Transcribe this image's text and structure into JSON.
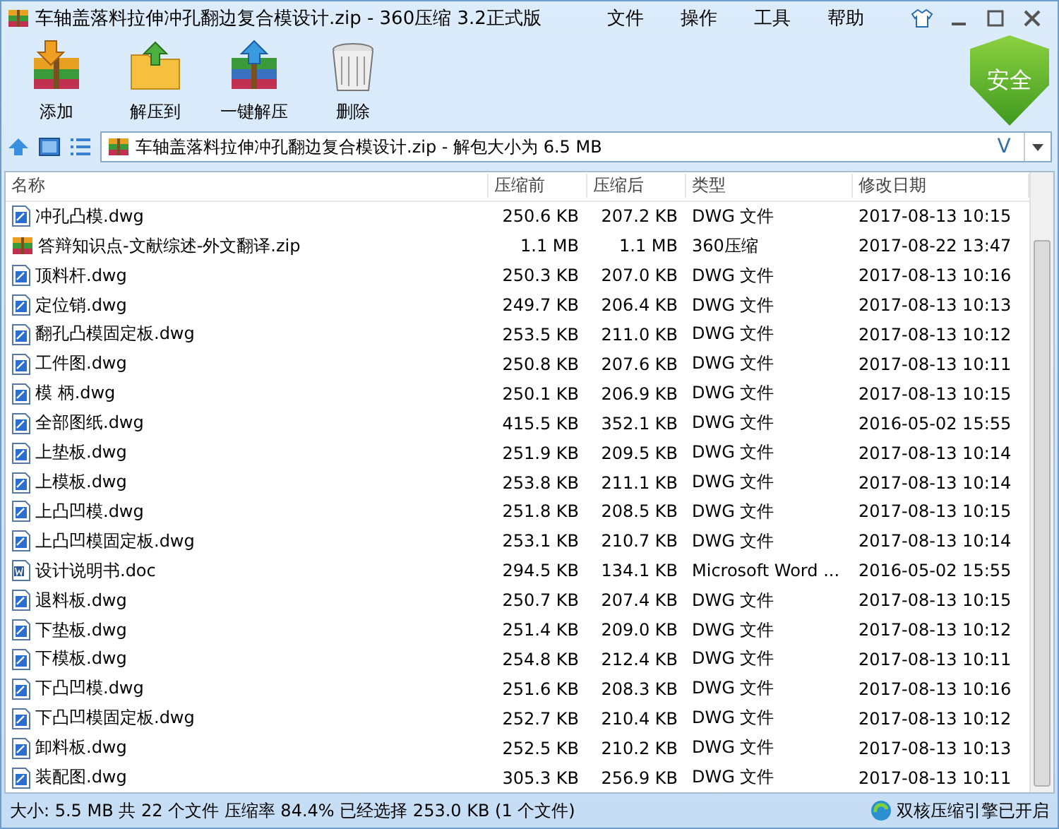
{
  "window": {
    "title": "车轴盖落料拉伸冲孔翻边复合模设计.zip - 360压缩 3.2正式版"
  },
  "menu": [
    "文件",
    "操作",
    "工具",
    "帮助"
  ],
  "toolbar": [
    {
      "label": "添加",
      "kind": "add"
    },
    {
      "label": "解压到",
      "kind": "extract"
    },
    {
      "label": "一键解压",
      "kind": "oneclick"
    },
    {
      "label": "删除",
      "kind": "delete"
    }
  ],
  "security_badge": "安全",
  "address": {
    "value": "车轴盖落料拉伸冲孔翻边复合模设计.zip - 解包大小为 6.5 MB",
    "dropdown_glyph": "V"
  },
  "table": {
    "columns": [
      "名称",
      "压缩前",
      "压缩后",
      "类型",
      "修改日期"
    ],
    "rows": [
      {
        "kind": "dwg",
        "cells": [
          "冲孔凸模.dwg",
          "250.6 KB",
          "207.2 KB",
          "DWG 文件",
          "2017-08-13 10:15"
        ]
      },
      {
        "kind": "zip",
        "cells": [
          "答辩知识点-文献综述-外文翻译.zip",
          "1.1 MB",
          "1.1 MB",
          "360压缩",
          "2017-08-22 13:47"
        ]
      },
      {
        "kind": "dwg",
        "cells": [
          "顶料杆.dwg",
          "250.3 KB",
          "207.0 KB",
          "DWG 文件",
          "2017-08-13 10:16"
        ]
      },
      {
        "kind": "dwg",
        "cells": [
          "定位销.dwg",
          "249.7 KB",
          "206.4 KB",
          "DWG 文件",
          "2017-08-13 10:13"
        ]
      },
      {
        "kind": "dwg",
        "cells": [
          "翻孔凸模固定板.dwg",
          "253.5 KB",
          "211.0 KB",
          "DWG 文件",
          "2017-08-13 10:12"
        ]
      },
      {
        "kind": "dwg",
        "cells": [
          "工件图.dwg",
          "250.8 KB",
          "207.6 KB",
          "DWG 文件",
          "2017-08-13 10:11"
        ]
      },
      {
        "kind": "dwg",
        "cells": [
          "模  柄.dwg",
          "250.1 KB",
          "206.9 KB",
          "DWG 文件",
          "2017-08-13 10:15"
        ]
      },
      {
        "kind": "dwg",
        "cells": [
          "全部图纸.dwg",
          "415.5 KB",
          "352.1 KB",
          "DWG 文件",
          "2016-05-02 15:55"
        ]
      },
      {
        "kind": "dwg",
        "cells": [
          "上垫板.dwg",
          "251.9 KB",
          "209.5 KB",
          "DWG 文件",
          "2017-08-13 10:14"
        ]
      },
      {
        "kind": "dwg",
        "cells": [
          "上模板.dwg",
          "253.8 KB",
          "211.1 KB",
          "DWG 文件",
          "2017-08-13 10:14"
        ]
      },
      {
        "kind": "dwg",
        "cells": [
          "上凸凹模.dwg",
          "251.8 KB",
          "208.5 KB",
          "DWG 文件",
          "2017-08-13 10:15"
        ]
      },
      {
        "kind": "dwg",
        "cells": [
          "上凸凹模固定板.dwg",
          "253.1 KB",
          "210.7 KB",
          "DWG 文件",
          "2017-08-13 10:14"
        ]
      },
      {
        "kind": "doc",
        "cells": [
          "设计说明书.doc",
          "294.5 KB",
          "134.1 KB",
          "Microsoft Word ...",
          "2016-05-02 15:55"
        ]
      },
      {
        "kind": "dwg",
        "cells": [
          "退料板.dwg",
          "250.7 KB",
          "207.4 KB",
          "DWG 文件",
          "2017-08-13 10:15"
        ]
      },
      {
        "kind": "dwg",
        "cells": [
          "下垫板.dwg",
          "251.4 KB",
          "209.0 KB",
          "DWG 文件",
          "2017-08-13 10:12"
        ]
      },
      {
        "kind": "dwg",
        "cells": [
          "下模板.dwg",
          "254.8 KB",
          "212.4 KB",
          "DWG 文件",
          "2017-08-13 10:11"
        ]
      },
      {
        "kind": "dwg",
        "cells": [
          "下凸凹模.dwg",
          "251.6 KB",
          "208.3 KB",
          "DWG 文件",
          "2017-08-13 10:16"
        ]
      },
      {
        "kind": "dwg",
        "cells": [
          "下凸凹模固定板.dwg",
          "252.7 KB",
          "210.4 KB",
          "DWG 文件",
          "2017-08-13 10:12"
        ]
      },
      {
        "kind": "dwg",
        "cells": [
          "卸料板.dwg",
          "252.5 KB",
          "210.2 KB",
          "DWG 文件",
          "2017-08-13 10:13"
        ]
      },
      {
        "kind": "dwg",
        "cells": [
          "装配图.dwg",
          "305.3 KB",
          "256.9 KB",
          "DWG 文件",
          "2017-08-13 10:11"
        ]
      }
    ]
  },
  "status_bar": {
    "text": "大小: 5.5 MB 共 22 个文件 压缩率 84.4% 已经选择 253.0 KB (1 个文件)",
    "engine": "双核压缩引擎已开启"
  }
}
